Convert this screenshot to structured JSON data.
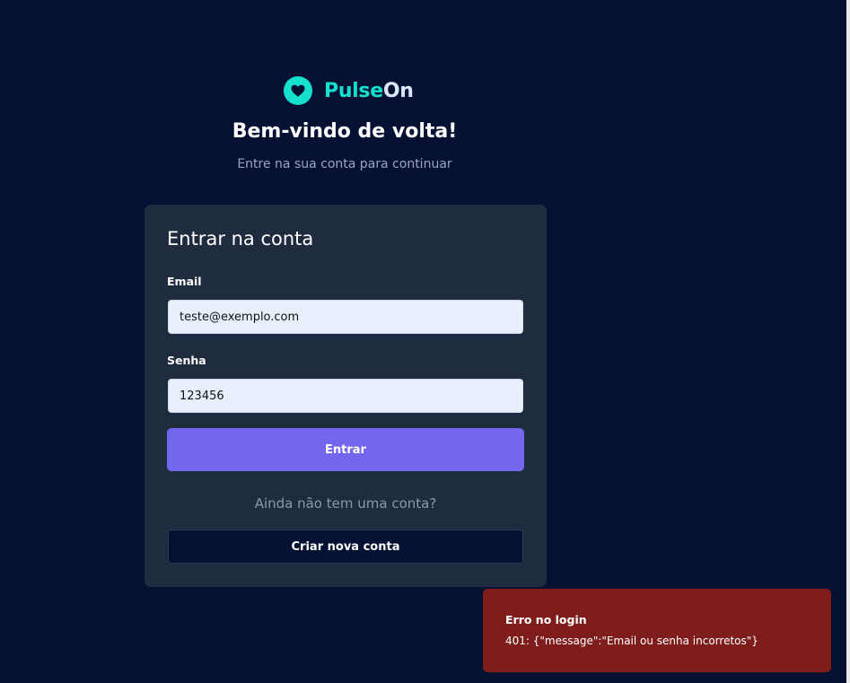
{
  "brand": {
    "name_part1": "Pulse",
    "name_part2": "On",
    "icon": "heart-icon",
    "color": "#14e0cc"
  },
  "header": {
    "title": "Bem-vindo de volta!",
    "subtitle": "Entre na sua conta para continuar"
  },
  "login_card": {
    "title": "Entrar na conta",
    "email_label": "Email",
    "email_value": "teste@exemplo.com",
    "password_label": "Senha",
    "password_value": "123456",
    "submit_label": "Entrar",
    "no_account_text": "Ainda não tem uma conta?",
    "create_account_label": "Criar nova conta"
  },
  "toast": {
    "title": "Erro no login",
    "message": "401: {\"message\":\"Email ou senha incorretos\"}"
  },
  "colors": {
    "background": "#031233",
    "card": "#1f2b3e",
    "accent": "#7367f0",
    "brand": "#14e0cc",
    "error": "#7f1d1d"
  }
}
